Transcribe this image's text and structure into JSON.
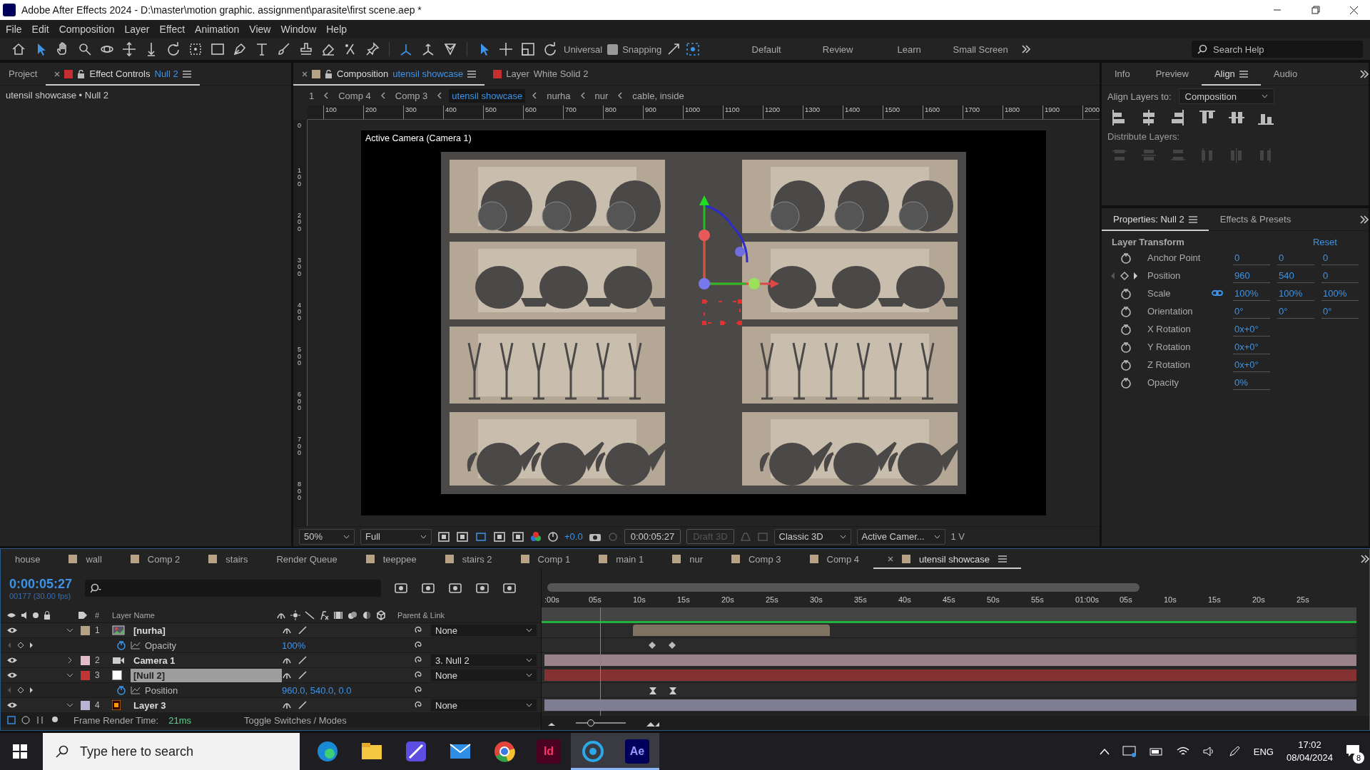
{
  "window": {
    "title": "Adobe After Effects 2024 - D:\\master\\motion graphic. assignment\\parasite\\first scene.aep *"
  },
  "menu": [
    "File",
    "Edit",
    "Composition",
    "Layer",
    "Effect",
    "Animation",
    "View",
    "Window",
    "Help"
  ],
  "toolbar": {
    "axis_mode": "Universal",
    "snapping": {
      "label": "Snapping",
      "checked": true
    },
    "workspaces": [
      "Default",
      "Review",
      "Learn",
      "Small Screen"
    ],
    "search": {
      "placeholder": "Search Help"
    }
  },
  "left_panel": {
    "tabs": [
      {
        "label": "Project",
        "selected": false
      },
      {
        "label": "Effect Controls",
        "target": "Null 2",
        "selected": true
      }
    ],
    "breadcrumb": "utensil showcase • Null 2"
  },
  "composition_panel": {
    "tabs": [
      {
        "kind": "composition",
        "label": "Composition",
        "target": "utensil showcase",
        "selected": true
      },
      {
        "kind": "layer",
        "label": "Layer",
        "target": "White Solid 2",
        "selected": false
      }
    ],
    "flowchart": [
      {
        "label": "1",
        "selected": false
      },
      {
        "label": "Comp 4",
        "selected": false
      },
      {
        "label": "Comp 3",
        "selected": false
      },
      {
        "label": "utensil showcase",
        "selected": true
      },
      {
        "label": "nurha",
        "selected": false
      },
      {
        "label": "nur",
        "selected": false
      },
      {
        "label": "cable, inside",
        "selected": false
      }
    ],
    "ruler": [
      "100",
      "200",
      "300",
      "400",
      "500",
      "600",
      "700",
      "800",
      "900",
      "1000",
      "1100",
      "1200",
      "1300",
      "1400",
      "1500",
      "1600",
      "1700",
      "1800",
      "1900",
      "2000"
    ],
    "vertical_ruler": [
      "0",
      "100",
      "200",
      "300",
      "400",
      "500",
      "600",
      "700",
      "800"
    ],
    "viewer_label": "Active Camera (Camera 1)",
    "viewer_bar": {
      "magnification": "50%",
      "resolution": "Full",
      "exposure": "+0.0",
      "timecode": "0:00:05:27",
      "draft_3d": {
        "label": "Draft 3D",
        "disabled": true
      },
      "renderer": "Classic 3D",
      "view": "Active Camer...",
      "view_layout": "1 V"
    }
  },
  "right_panel": {
    "tabs": [
      {
        "label": "Info",
        "selected": false
      },
      {
        "label": "Preview",
        "selected": false
      },
      {
        "label": "Align",
        "selected": true
      },
      {
        "label": "Audio",
        "selected": false
      }
    ],
    "align_to_label": "Align Layers to:",
    "align_to": "Composition",
    "distribute_label": "Distribute Layers:",
    "properties_tabs": [
      {
        "label": "Properties: Null 2",
        "selected": true
      },
      {
        "label": "Effects & Presets",
        "selected": false
      }
    ],
    "section": "Layer Transform",
    "reset": "Reset",
    "properties": [
      {
        "name": "Anchor Point",
        "keyframed": false,
        "values": [
          "0",
          "0",
          "0"
        ]
      },
      {
        "name": "Position",
        "keyframed": true,
        "values": [
          "960",
          "540",
          "0"
        ]
      },
      {
        "name": "Scale",
        "keyframed": false,
        "linked": true,
        "values": [
          "100%",
          "100%",
          "100%"
        ]
      },
      {
        "name": "Orientation",
        "keyframed": false,
        "values": [
          "0°",
          "0°",
          "0°"
        ]
      },
      {
        "name": "X Rotation",
        "keyframed": false,
        "values": [
          "0x+0°"
        ]
      },
      {
        "name": "Y Rotation",
        "keyframed": false,
        "values": [
          "0x+0°"
        ]
      },
      {
        "name": "Z Rotation",
        "keyframed": false,
        "values": [
          "0x+0°"
        ]
      },
      {
        "name": "Opacity",
        "keyframed": false,
        "values": [
          "0%"
        ]
      }
    ]
  },
  "timeline": {
    "tabs": [
      {
        "kind": "plain",
        "label": "house",
        "selected": false
      },
      {
        "kind": "composition",
        "label": "wall",
        "selected": false
      },
      {
        "kind": "composition",
        "label": "Comp 2",
        "selected": false
      },
      {
        "kind": "composition",
        "label": "stairs",
        "selected": false
      },
      {
        "kind": "plain",
        "label": "Render Queue",
        "selected": false
      },
      {
        "kind": "composition",
        "label": "teeppee",
        "selected": false
      },
      {
        "kind": "composition",
        "label": "stairs 2",
        "selected": false
      },
      {
        "kind": "composition",
        "label": "Comp 1",
        "selected": false
      },
      {
        "kind": "composition",
        "label": "main 1",
        "selected": false
      },
      {
        "kind": "composition",
        "label": "nur",
        "selected": false
      },
      {
        "kind": "composition",
        "label": "Comp 3",
        "selected": false
      },
      {
        "kind": "composition",
        "label": "Comp 4",
        "selected": false
      },
      {
        "kind": "composition",
        "label": "utensil showcase",
        "selected": true
      }
    ],
    "timecode": "0:00:05:27",
    "frames": "00177 (30.00 fps)",
    "columns": {
      "number": "#",
      "name": "Layer Name",
      "parent": "Parent & Link"
    },
    "time_labels": [
      ":00s",
      "05s",
      "10s",
      "15s",
      "20s",
      "25s",
      "30s",
      "35s",
      "40s",
      "45s",
      "50s",
      "55s",
      "01:00s",
      "05s",
      "10s",
      "15s",
      "20s",
      "25s"
    ],
    "layers": [
      {
        "kind": "footage",
        "number": "1",
        "name": "[nurha]",
        "color": "#b4a383",
        "expanded": true,
        "selected": false,
        "parent": "None"
      },
      {
        "kind": "linear_property",
        "name": "Opacity",
        "value": "100%"
      },
      {
        "kind": "camera",
        "number": "2",
        "name": "Camera 1",
        "color": "#e3bcc8",
        "expanded": false,
        "selected": false,
        "parent": "3. Null 2"
      },
      {
        "kind": "null",
        "number": "3",
        "name": "[Null 2]",
        "color": "#c33535",
        "expanded": true,
        "selected": true,
        "parent": "None"
      },
      {
        "kind": "hold_property",
        "name": "Position",
        "value": "960.0, 540.0, 0.0"
      },
      {
        "kind": "illustrator",
        "number": "4",
        "name": "Layer 3",
        "color": "#b7b4d6",
        "expanded": true,
        "selected": false,
        "parent": "None"
      }
    ],
    "footer": {
      "label": "Frame Render Time:",
      "value": "21ms",
      "toggle": "Toggle Switches / Modes",
      "zoom": {
        "level": 0.3
      }
    }
  },
  "taskbar": {
    "search": {
      "placeholder": "Type here to search"
    },
    "apps": [
      {
        "kind": "edge",
        "selected": false
      },
      {
        "kind": "files",
        "selected": false
      },
      {
        "kind": "studio",
        "selected": false
      },
      {
        "kind": "mail",
        "selected": false
      },
      {
        "kind": "chrome",
        "selected": false
      },
      {
        "kind": "indesign",
        "label": "Id",
        "selected": false
      },
      {
        "kind": "browser",
        "selected": true
      },
      {
        "kind": "aftereffects",
        "label": "Ae",
        "selected": true
      }
    ],
    "language": "ENG",
    "time": "17:02",
    "date": "08/04/2024",
    "notifications": "8"
  }
}
